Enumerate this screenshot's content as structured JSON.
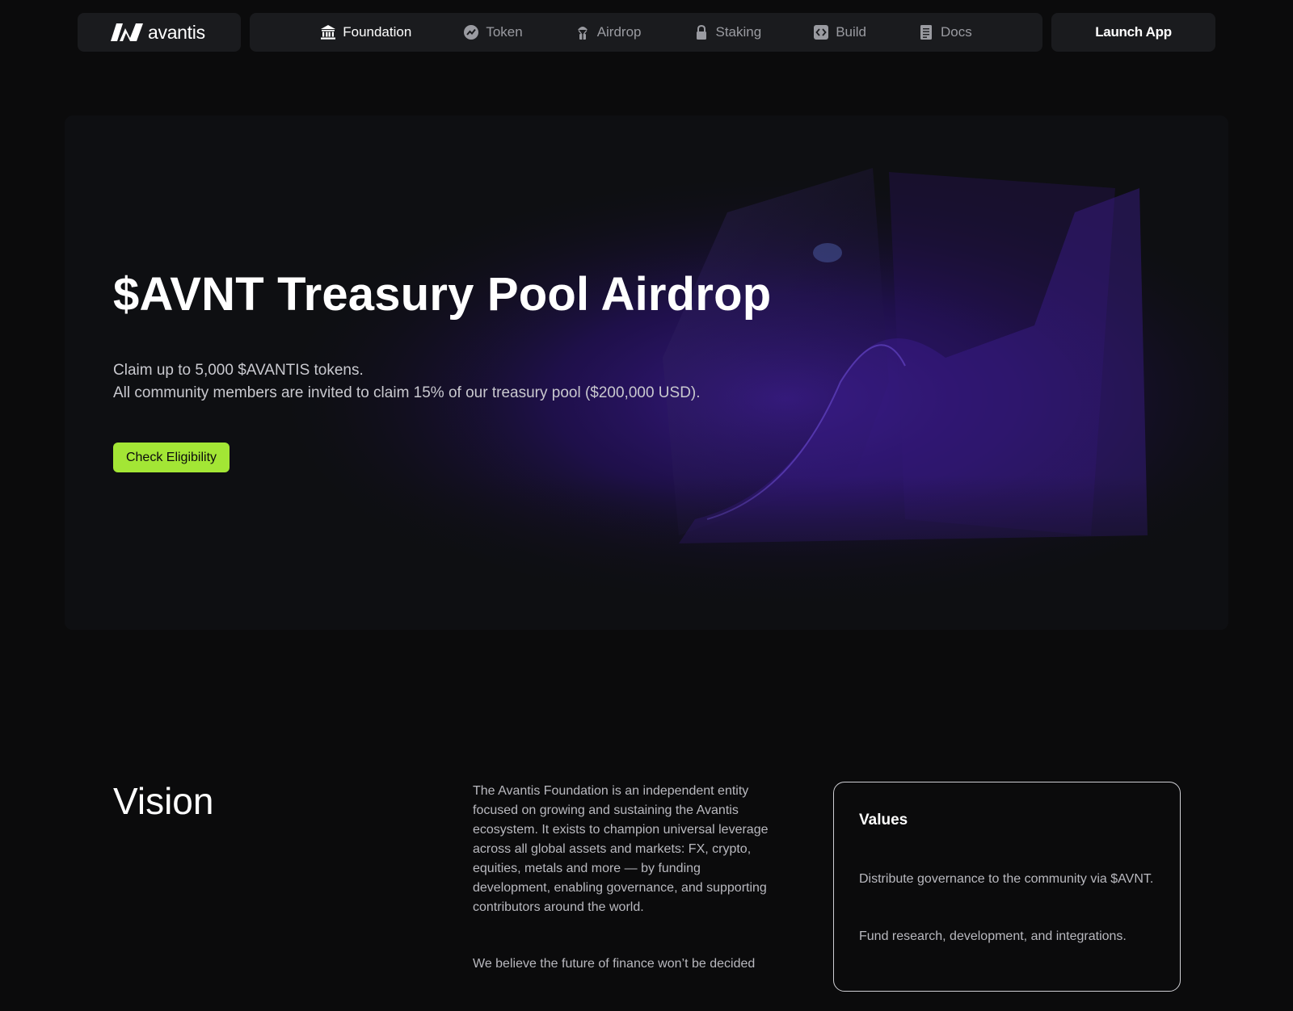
{
  "brand": {
    "name": "avantis",
    "accent": "#a3e635"
  },
  "nav": {
    "items": [
      {
        "label": "Foundation",
        "icon": "bank-icon",
        "active": true
      },
      {
        "label": "Token",
        "icon": "token-chart-icon",
        "active": false
      },
      {
        "label": "Airdrop",
        "icon": "airdrop-icon",
        "active": false
      },
      {
        "label": "Staking",
        "icon": "lock-icon",
        "active": false
      },
      {
        "label": "Build",
        "icon": "code-icon",
        "active": false
      },
      {
        "label": "Docs",
        "icon": "document-icon",
        "active": false
      }
    ],
    "launch_label": "Launch App"
  },
  "hero": {
    "title": "$AVNT Treasury Pool Airdrop",
    "subtitle_line1": "Claim up to 5,000 $AVANTIS tokens.",
    "subtitle_line2": "All community members are invited to claim 15% of our treasury pool ($200,000 USD).",
    "cta_label": "Check Eligibility"
  },
  "vision": {
    "title": "Vision",
    "paragraph1": "The Avantis Foundation is an independent entity focused on growing and sustaining the Avantis ecosystem. It exists to champion universal leverage across all global assets and markets: FX, crypto, equities, metals and more — by funding development, enabling governance, and supporting contributors around the world.",
    "paragraph2": "We believe the future of finance won’t be decided"
  },
  "values": {
    "title": "Values",
    "items": [
      "Distribute governance to the community via $AVNT.",
      "Fund research, development, and integrations."
    ]
  }
}
